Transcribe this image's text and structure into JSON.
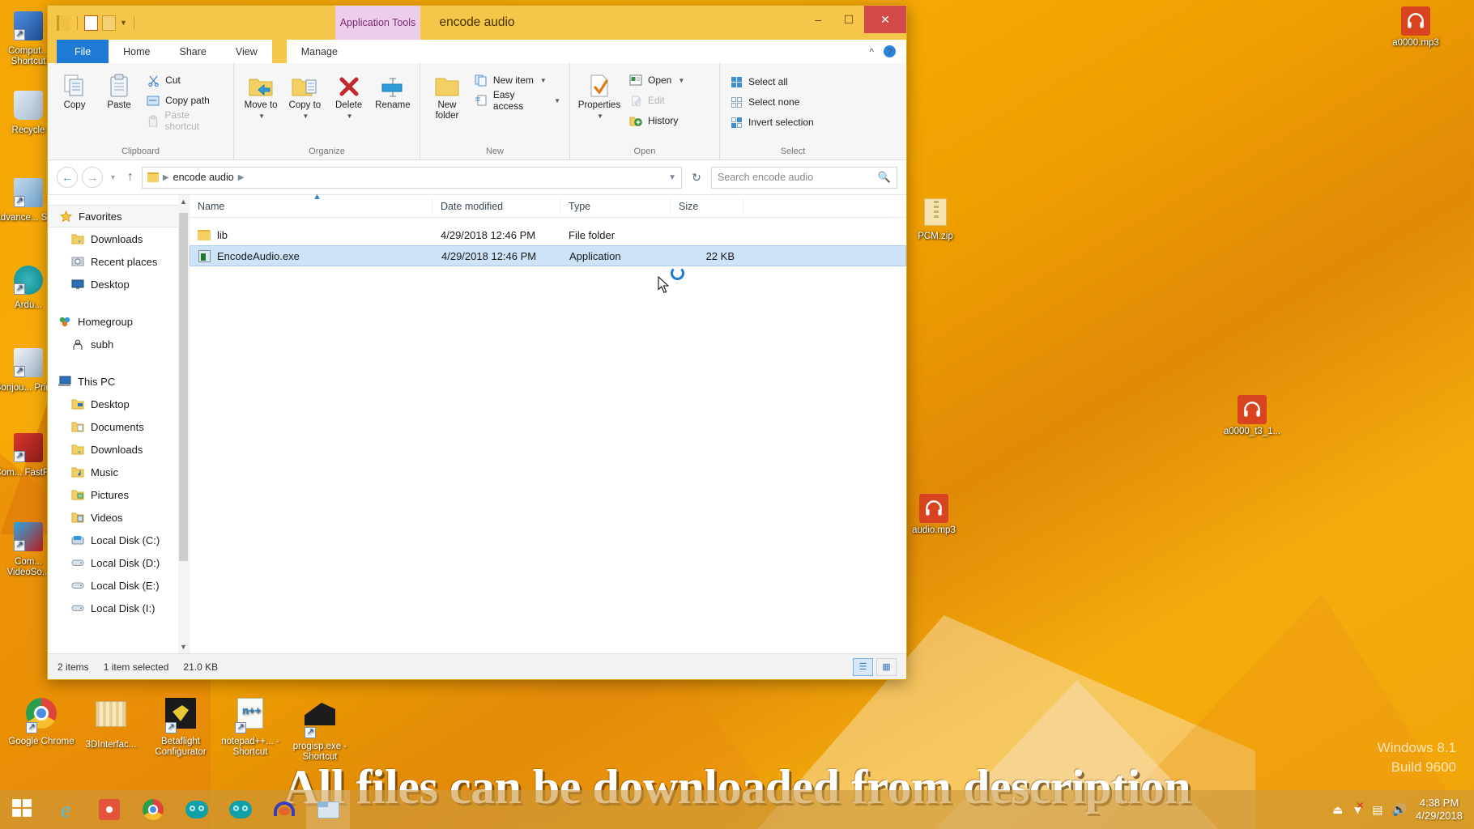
{
  "desktop": {
    "icons_left": [
      {
        "label": "Comput... Shortcut",
        "type": "shortcut-computer"
      },
      {
        "label": "Recycle",
        "type": "recycle-bin"
      },
      {
        "label": "Advance... Scan",
        "type": "shortcut-scan"
      },
      {
        "label": "Ardu...",
        "type": "shortcut-arduino"
      },
      {
        "label": "Bonjou... Printer",
        "type": "shortcut-printer"
      },
      {
        "label": "Com... FastFlick",
        "type": "shortcut-fastflick"
      },
      {
        "label": "Com... VideoSo...",
        "type": "shortcut-video"
      }
    ],
    "icons_right": [
      {
        "label": "a0000.mp3",
        "type": "mp3"
      },
      {
        "label": "PCM.zip",
        "type": "zip"
      },
      {
        "label": "a0000_t3_1...",
        "type": "mp3"
      },
      {
        "label": "audio.mp3",
        "type": "mp3"
      }
    ],
    "shortcuts_bottom": [
      {
        "label": "Google Chrome",
        "type": "chrome"
      },
      {
        "label": "3DInterfac...",
        "type": "folder-stack"
      },
      {
        "label": "Betaflight Configurator",
        "type": "betaflight"
      },
      {
        "label": "notepad++... - Shortcut",
        "type": "notepad"
      },
      {
        "label": "progisp.exe - Shortcut",
        "type": "progisp"
      }
    ],
    "watermark": {
      "line1": "Windows 8.1",
      "line2": "Build 9600"
    }
  },
  "subtitle": "All files can be downloaded from description",
  "window": {
    "title": "encode audio",
    "contextual_tab": "Application Tools",
    "controls": {
      "minimize": "–",
      "maximize": "❐",
      "close": "✕"
    },
    "tabs": [
      {
        "label": "File",
        "kind": "file"
      },
      {
        "label": "Home",
        "kind": "active"
      },
      {
        "label": "Share",
        "kind": "normal"
      },
      {
        "label": "View",
        "kind": "normal"
      },
      {
        "label": "Manage",
        "kind": "contextual"
      }
    ],
    "ribbon_groups": [
      {
        "label": "Clipboard",
        "big": [
          {
            "label": "Copy",
            "icon": "copy-icon",
            "dim": false
          },
          {
            "label": "Paste",
            "icon": "paste-icon",
            "dim": false
          }
        ],
        "small": [
          {
            "label": "Cut",
            "icon": "scissors-icon",
            "dim": false
          },
          {
            "label": "Copy path",
            "icon": "copy-path-icon",
            "dim": false
          },
          {
            "label": "Paste shortcut",
            "icon": "paste-shortcut-icon",
            "dim": true
          }
        ]
      },
      {
        "label": "Organize",
        "big": [
          {
            "label": "Move to",
            "icon": "move-to-icon",
            "dropdown": true
          },
          {
            "label": "Copy to",
            "icon": "copy-to-icon",
            "dropdown": true
          },
          {
            "label": "Delete",
            "icon": "delete-icon",
            "dropdown": true
          },
          {
            "label": "Rename",
            "icon": "rename-icon",
            "dropdown": false
          }
        ],
        "small": []
      },
      {
        "label": "New",
        "big": [
          {
            "label": "New folder",
            "icon": "new-folder-icon",
            "dropdown": false
          }
        ],
        "small": [
          {
            "label": "New item",
            "icon": "new-item-icon",
            "dropdown": true
          },
          {
            "label": "Easy access",
            "icon": "easy-access-icon",
            "dropdown": true
          }
        ]
      },
      {
        "label": "Open",
        "big": [
          {
            "label": "Properties",
            "icon": "properties-icon",
            "dropdown": true
          }
        ],
        "small": [
          {
            "label": "Open",
            "icon": "open-icon",
            "dropdown": true,
            "dim": false
          },
          {
            "label": "Edit",
            "icon": "edit-icon",
            "dim": true
          },
          {
            "label": "History",
            "icon": "history-icon",
            "dim": false
          }
        ]
      },
      {
        "label": "Select",
        "big": [],
        "small": [
          {
            "label": "Select all",
            "icon": "select-all-icon"
          },
          {
            "label": "Select none",
            "icon": "select-none-icon"
          },
          {
            "label": "Invert selection",
            "icon": "invert-selection-icon"
          }
        ]
      }
    ],
    "address": {
      "back_icon": "back-arrow-icon",
      "forward_icon": "forward-arrow-icon",
      "recent_icon": "chevron-down-icon",
      "up_icon": "up-arrow-icon",
      "crumbs": [
        "encode audio"
      ],
      "refresh_icon": "refresh-icon"
    },
    "search": {
      "placeholder": "Search encode audio",
      "icon": "search-icon"
    },
    "navpane": {
      "sections": [
        {
          "header": {
            "label": "Favorites",
            "icon": "star-icon",
            "selected": true
          },
          "items": [
            {
              "label": "Downloads",
              "icon": "downloads-folder-icon"
            },
            {
              "label": "Recent places",
              "icon": "recent-places-icon"
            },
            {
              "label": "Desktop",
              "icon": "desktop-icon"
            }
          ]
        },
        {
          "header": {
            "label": "Homegroup",
            "icon": "homegroup-icon",
            "selected": false
          },
          "items": [
            {
              "label": "subh",
              "icon": "user-icon"
            }
          ]
        },
        {
          "header": {
            "label": "This PC",
            "icon": "this-pc-icon",
            "selected": false
          },
          "items": [
            {
              "label": "Desktop",
              "icon": "desktop-folder-icon"
            },
            {
              "label": "Documents",
              "icon": "documents-folder-icon"
            },
            {
              "label": "Downloads",
              "icon": "downloads-folder-icon"
            },
            {
              "label": "Music",
              "icon": "music-folder-icon"
            },
            {
              "label": "Pictures",
              "icon": "pictures-folder-icon"
            },
            {
              "label": "Videos",
              "icon": "videos-folder-icon"
            },
            {
              "label": "Local Disk (C:)",
              "icon": "system-drive-icon"
            },
            {
              "label": "Local Disk (D:)",
              "icon": "drive-icon"
            },
            {
              "label": "Local Disk (E:)",
              "icon": "drive-icon"
            },
            {
              "label": "Local Disk (I:)",
              "icon": "drive-icon"
            }
          ]
        }
      ]
    },
    "filelist": {
      "columns": [
        "Name",
        "Date modified",
        "Type",
        "Size"
      ],
      "rows": [
        {
          "name": "lib",
          "date": "4/29/2018 12:46 PM",
          "type": "File folder",
          "size": "",
          "icon": "folder-icon",
          "selected": false
        },
        {
          "name": "EncodeAudio.exe",
          "date": "4/29/2018 12:46 PM",
          "type": "Application",
          "size": "22 KB",
          "icon": "exe-icon",
          "selected": true
        }
      ]
    },
    "statusbar": {
      "items_count": "2 items",
      "selection": "1 item selected",
      "selection_size": "21.0 KB",
      "view_details_icon": "details-view-icon",
      "view_large_icon": "large-icons-view-icon"
    }
  },
  "taskbar": {
    "start_icon": "windows-start-icon",
    "items": [
      {
        "icon": "internet-explorer-icon",
        "running": false
      },
      {
        "icon": "xsplit-icon",
        "running": false
      },
      {
        "icon": "chrome-icon",
        "running": false
      },
      {
        "icon": "arduino-icon",
        "running": false
      },
      {
        "icon": "arduino-icon",
        "running": false
      },
      {
        "icon": "audacity-icon",
        "running": false
      },
      {
        "icon": "explorer-icon",
        "running": true
      }
    ],
    "tray": [
      {
        "icon": "usb-eject-icon"
      },
      {
        "icon": "network-error-icon"
      },
      {
        "icon": "usb-icon"
      },
      {
        "icon": "volume-icon"
      }
    ],
    "clock": {
      "time": "4:38 PM",
      "date": "4/29/2018"
    }
  },
  "colors": {
    "desktop": "#f5a80a",
    "title_bar": "#f6c64b",
    "contextual_tab": "#eccdea",
    "selection": "#cde3f7",
    "accent": "#1e7ad4",
    "close_button": "#d44a4a",
    "mp3_icon": "#d8441f"
  }
}
